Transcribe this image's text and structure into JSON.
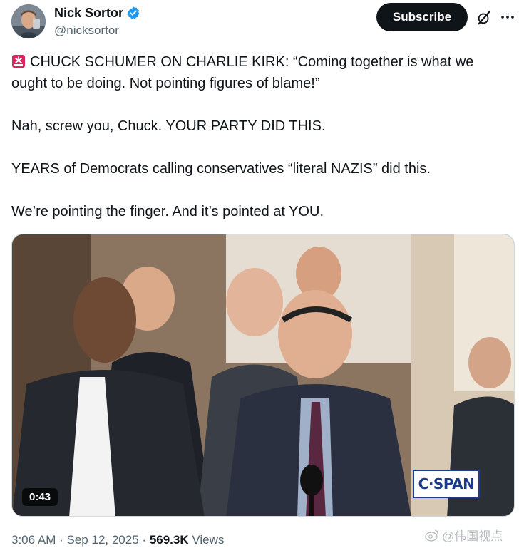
{
  "author": {
    "display_name": "Nick Sortor",
    "handle": "@nicksortor",
    "verified": true,
    "avatar_icon": "profile-photo"
  },
  "actions": {
    "subscribe_label": "Subscribe",
    "grok_icon": "grok-icon",
    "more_icon": "more-icon"
  },
  "tweet": {
    "lines": [
      "CHUCK SCHUMER ON CHARLIE KIRK: “Coming together is what we ought to be doing. Not pointing figures of blame!”",
      "Nah, screw you, Chuck. YOUR PARTY DID THIS.",
      "YEARS of Democrats calling conservatives “literal NAZIS” did this.",
      "We’re pointing the finger. And it’s pointed at YOU."
    ],
    "leading_emoji": "siren-icon"
  },
  "media": {
    "duration": "0:43",
    "network_logo": "C·SPAN"
  },
  "meta": {
    "time": "3:06 AM",
    "separator": "·",
    "date": "Sep 12, 2025",
    "views_count": "569.3K",
    "views_label": "Views"
  },
  "watermark": {
    "text": "@伟国视点"
  },
  "colors": {
    "text_primary": "#0f1419",
    "text_secondary": "#536471",
    "verified_blue": "#1d9bf0",
    "button_bg": "#0f1419"
  }
}
